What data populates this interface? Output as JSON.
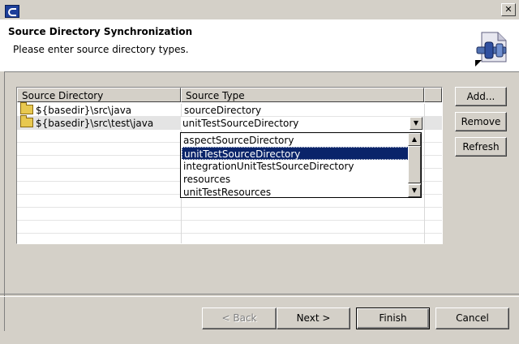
{
  "window": {
    "close_glyph": "✕"
  },
  "header": {
    "title": "Source Directory Synchronization",
    "description": "Please enter source directory types."
  },
  "table": {
    "columns": [
      "Source Directory",
      "Source Type"
    ],
    "rows": [
      {
        "directory": "${basedir}\\src\\java",
        "type": "sourceDirectory"
      },
      {
        "directory": "${basedir}\\src\\test\\java",
        "type": "unitTestSourceDirectory"
      }
    ]
  },
  "combo": {
    "value": "unitTestSourceDirectory",
    "options": [
      "aspectSourceDirectory",
      "unitTestSourceDirectory",
      "integrationUnitTestSourceDirectory",
      "resources",
      "unitTestResources"
    ],
    "selected_index": 1
  },
  "side_buttons": {
    "add": "Add...",
    "remove": "Remove",
    "refresh": "Refresh"
  },
  "footer": {
    "back": "< Back",
    "next": "Next >",
    "finish": "Finish",
    "cancel": "Cancel"
  },
  "icons": {
    "window": "eclipse-icon",
    "folder": "folder-icon",
    "wizard": "plugin-wizard-icon"
  },
  "colors": {
    "selection": "#0a246a",
    "dialog_bg": "#d4d0c8"
  }
}
